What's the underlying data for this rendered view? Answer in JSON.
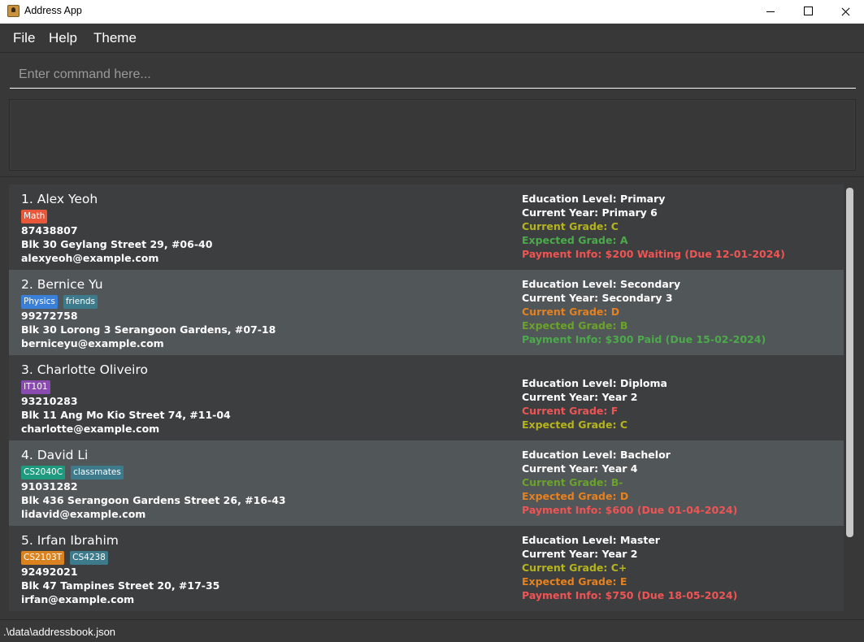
{
  "window": {
    "title": "Address App"
  },
  "menu": {
    "file": "File",
    "help": "Help",
    "theme": "Theme"
  },
  "command": {
    "placeholder": "Enter command here..."
  },
  "result": {
    "text": ""
  },
  "status": {
    "path": ".\\data\\addressbook.json"
  },
  "colors": {
    "background": "#383838",
    "card_odd": "#3c3e3f",
    "card_even": "#515658",
    "grade_yellow": "#b6b41c",
    "grade_green": "#4caa4c",
    "grade_orange": "#e6811f",
    "grade_red": "#f05454",
    "grade_olive": "#6ba32a"
  },
  "persons": [
    {
      "name": "1. Alex Yeoh",
      "tags": [
        {
          "label": "Math",
          "color": "#e8573a"
        }
      ],
      "phone": "87438807",
      "address": "Blk 30 Geylang Street 29, #06-40",
      "email": "alexyeoh@example.com",
      "info": [
        {
          "text": "Education Level: Primary",
          "color": "#ffffff"
        },
        {
          "text": "Current Year: Primary 6",
          "color": "#ffffff"
        },
        {
          "text": "Current Grade: C",
          "color": "#b6b41c"
        },
        {
          "text": "Expected Grade: A",
          "color": "#4caa4c"
        },
        {
          "text": "Payment Info: $200 Waiting (Due 12-01-2024)",
          "color": "#f05454"
        }
      ]
    },
    {
      "name": "2. Bernice Yu",
      "tags": [
        {
          "label": "Physics",
          "color": "#3a7fd8"
        },
        {
          "label": "friends",
          "color": "#3d7a8c"
        }
      ],
      "phone": "99272758",
      "address": "Blk 30 Lorong 3 Serangoon Gardens, #07-18",
      "email": "berniceyu@example.com",
      "info": [
        {
          "text": "Education Level: Secondary",
          "color": "#ffffff"
        },
        {
          "text": "Current Year: Secondary 3",
          "color": "#ffffff"
        },
        {
          "text": "Current Grade: D",
          "color": "#e6811f"
        },
        {
          "text": "Expected Grade: B",
          "color": "#6ba32a"
        },
        {
          "text": "Payment Info: $300 Paid (Due 15-02-2024)",
          "color": "#4caa4c"
        }
      ]
    },
    {
      "name": "3. Charlotte Oliveiro",
      "tags": [
        {
          "label": "IT101",
          "color": "#8a4bb0"
        }
      ],
      "phone": "93210283",
      "address": "Blk 11 Ang Mo Kio Street 74, #11-04",
      "email": "charlotte@example.com",
      "info": [
        {
          "text": "Education Level: Diploma",
          "color": "#ffffff"
        },
        {
          "text": "Current Year: Year 2",
          "color": "#ffffff"
        },
        {
          "text": "Current Grade: F",
          "color": "#f05454"
        },
        {
          "text": "Expected Grade: C",
          "color": "#b6b41c"
        }
      ]
    },
    {
      "name": "4. David Li",
      "tags": [
        {
          "label": "CS2040C",
          "color": "#1e9a7e"
        },
        {
          "label": "classmates",
          "color": "#3d7a8c"
        }
      ],
      "phone": "91031282",
      "address": "Blk 436 Serangoon Gardens Street 26, #16-43",
      "email": "lidavid@example.com",
      "info": [
        {
          "text": "Education Level: Bachelor",
          "color": "#ffffff"
        },
        {
          "text": "Current Year: Year 4",
          "color": "#ffffff"
        },
        {
          "text": "Current Grade: B-",
          "color": "#6ba32a"
        },
        {
          "text": "Expected Grade: D",
          "color": "#e6811f"
        },
        {
          "text": "Payment Info: $600 (Due 01-04-2024)",
          "color": "#f05454"
        }
      ]
    },
    {
      "name": "5. Irfan Ibrahim",
      "tags": [
        {
          "label": "CS2103T",
          "color": "#d9821f"
        },
        {
          "label": "CS4238",
          "color": "#3d7a8c"
        }
      ],
      "phone": "92492021",
      "address": "Blk 47 Tampines Street 20, #17-35",
      "email": "irfan@example.com",
      "info": [
        {
          "text": "Education Level: Master",
          "color": "#ffffff"
        },
        {
          "text": "Current Year: Year 2",
          "color": "#ffffff"
        },
        {
          "text": "Current Grade: C+",
          "color": "#b6b41c"
        },
        {
          "text": "Expected Grade: E",
          "color": "#e6811f"
        },
        {
          "text": "Payment Info: $750 (Due 18-05-2024)",
          "color": "#f05454"
        }
      ]
    }
  ]
}
